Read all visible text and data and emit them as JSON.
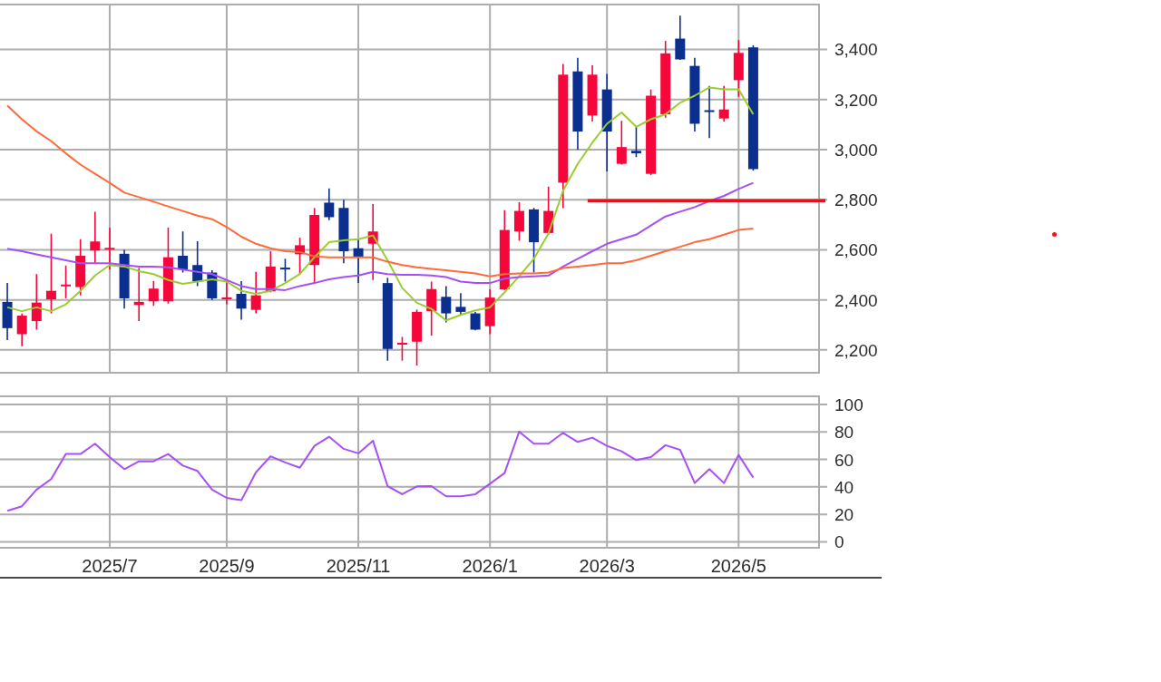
{
  "price_chart": {
    "chart_data": {
      "type": "candlestick",
      "grid": true,
      "ylim": [
        2109,
        3579
      ],
      "categories": [
        null,
        null,
        null,
        null,
        null,
        null,
        null,
        null,
        null,
        null,
        null,
        null,
        null,
        null,
        null,
        null,
        null,
        null,
        null,
        null,
        null,
        null,
        null,
        null,
        null,
        null,
        null,
        null,
        null,
        null,
        null,
        null,
        null,
        null,
        null,
        null,
        null,
        null,
        null,
        null,
        null,
        null,
        null,
        null,
        null,
        null,
        null,
        null,
        null,
        null,
        null,
        null,
        null,
        null,
        null,
        null
      ],
      "yticks": [
        {
          "value": 2200,
          "label": "2,200"
        },
        {
          "value": 2400,
          "label": "2,400"
        },
        {
          "value": 2600,
          "label": "2,600"
        },
        {
          "value": 2800,
          "label": "2,800"
        },
        {
          "value": 3000,
          "label": "3,000"
        },
        {
          "value": 3200,
          "label": "3,200"
        },
        {
          "value": 3400,
          "label": "3,400"
        }
      ],
      "ohlc": [
        [
          2392,
          2467,
          2239,
          2287
        ],
        [
          2263,
          2345,
          2215,
          2337
        ],
        [
          2315,
          2503,
          2281,
          2389
        ],
        [
          2402,
          2664,
          2346,
          2436
        ],
        [
          2455,
          2537,
          2406,
          2460
        ],
        [
          2451,
          2642,
          2418,
          2576
        ],
        [
          2597,
          2752,
          2546,
          2633
        ],
        [
          2602,
          2688,
          2521,
          2606
        ],
        [
          2584,
          2600,
          2365,
          2406
        ],
        [
          2379,
          2527,
          2315,
          2392
        ],
        [
          2394,
          2475,
          2376,
          2445
        ],
        [
          2394,
          2688,
          2385,
          2570
        ],
        [
          2576,
          2673,
          2509,
          2521
        ],
        [
          2539,
          2634,
          2455,
          2473
        ],
        [
          2509,
          2518,
          2400,
          2406
        ],
        [
          2404,
          2473,
          2382,
          2408
        ],
        [
          2424,
          2475,
          2321,
          2365
        ],
        [
          2360,
          2512,
          2346,
          2418
        ],
        [
          2434,
          2594,
          2430,
          2533
        ],
        [
          2527,
          2564,
          2473,
          2523
        ],
        [
          2582,
          2648,
          2503,
          2618
        ],
        [
          2539,
          2767,
          2467,
          2739
        ],
        [
          2788,
          2845,
          2718,
          2730
        ],
        [
          2767,
          2800,
          2546,
          2594
        ],
        [
          2606,
          2642,
          2467,
          2570
        ],
        [
          2624,
          2782,
          2479,
          2673
        ],
        [
          2467,
          2488,
          2157,
          2204
        ],
        [
          2222,
          2252,
          2157,
          2228
        ],
        [
          2233,
          2361,
          2138,
          2352
        ],
        [
          2355,
          2473,
          2257,
          2443
        ],
        [
          2412,
          2455,
          2310,
          2346
        ],
        [
          2372,
          2427,
          2337,
          2352
        ],
        [
          2346,
          2352,
          2278,
          2281
        ],
        [
          2295,
          2442,
          2263,
          2409
        ],
        [
          2442,
          2758,
          2439,
          2679
        ],
        [
          2673,
          2790,
          2636,
          2755
        ],
        [
          2761,
          2767,
          2509,
          2630
        ],
        [
          2667,
          2852,
          2660,
          2755
        ],
        [
          2868,
          3342,
          2766,
          3299
        ],
        [
          3312,
          3366,
          3000,
          3072
        ],
        [
          3136,
          3336,
          3112,
          3299
        ],
        [
          3240,
          3302,
          2913,
          3072
        ],
        [
          2943,
          3115,
          2940,
          3010
        ],
        [
          2995,
          3091,
          2970,
          2985
        ],
        [
          2903,
          3240,
          2898,
          3215
        ],
        [
          3141,
          3434,
          3127,
          3384
        ],
        [
          3443,
          3535,
          3358,
          3360
        ],
        [
          3334,
          3366,
          3072,
          3103
        ],
        [
          3157,
          3254,
          3046,
          3150
        ],
        [
          3124,
          3254,
          3112,
          3160
        ],
        [
          3277,
          3437,
          3211,
          3386
        ],
        [
          3408,
          3416,
          2916,
          2922
        ],
        null,
        null,
        null,
        null
      ],
      "series": [
        {
          "type": "line",
          "color": "#9ccd2e",
          "values": [
            2370,
            2355,
            2370,
            2355,
            2382,
            2436,
            2497,
            2539,
            2533,
            2515,
            2503,
            2479,
            2464,
            2473,
            2482,
            2473,
            2436,
            2424,
            2436,
            2467,
            2503,
            2570,
            2630,
            2638,
            2642,
            2657,
            2558,
            2448,
            2388,
            2364,
            2318,
            2340,
            2358,
            2370,
            2430,
            2494,
            2564,
            2665,
            2836,
            2943,
            3028,
            3103,
            3148,
            3091,
            3121,
            3141,
            3187,
            3215,
            3248,
            3240,
            3240,
            3141,
            null,
            null,
            null,
            null
          ]
        },
        {
          "type": "line",
          "color": "#a64ff5",
          "values": [
            2604,
            2594,
            2582,
            2570,
            2558,
            2546,
            2546,
            2546,
            2539,
            2533,
            2533,
            2530,
            2521,
            2512,
            2503,
            2479,
            2455,
            2443,
            2443,
            2439,
            2455,
            2467,
            2482,
            2491,
            2497,
            2512,
            2503,
            2500,
            2500,
            2497,
            2491,
            2473,
            2467,
            2467,
            2485,
            2491,
            2494,
            2497,
            2533,
            2564,
            2594,
            2624,
            2642,
            2660,
            2697,
            2733,
            2752,
            2770,
            2794,
            2815,
            2843,
            2867,
            null,
            null,
            null,
            null
          ]
        },
        {
          "type": "line",
          "color": "#ff6a3a",
          "values": [
            3175,
            3121,
            3073,
            3034,
            2985,
            2940,
            2903,
            2867,
            2828,
            2810,
            2792,
            2773,
            2755,
            2736,
            2722,
            2691,
            2652,
            2624,
            2606,
            2594,
            2591,
            2573,
            2570,
            2570,
            2570,
            2570,
            2552,
            2539,
            2530,
            2524,
            2518,
            2512,
            2506,
            2494,
            2503,
            2506,
            2506,
            2509,
            2527,
            2533,
            2539,
            2546,
            2546,
            2558,
            2576,
            2594,
            2612,
            2630,
            2642,
            2660,
            2679,
            2685,
            null,
            null,
            null,
            null
          ]
        }
      ],
      "ref_lines": [
        {
          "axis": "y",
          "value": 2796,
          "color": "#e8101c"
        }
      ]
    }
  },
  "indicator_chart": {
    "chart_data": {
      "type": "line",
      "grid": true,
      "ylim": [
        -4.3,
        105.9
      ],
      "categories": [
        null,
        null,
        null,
        null,
        null,
        null,
        null,
        "2025/7",
        null,
        null,
        null,
        null,
        null,
        null,
        null,
        "2025/9",
        null,
        null,
        null,
        null,
        null,
        null,
        null,
        null,
        "2025/11",
        null,
        null,
        null,
        null,
        null,
        null,
        null,
        null,
        "2026/1",
        null,
        null,
        null,
        null,
        null,
        null,
        null,
        "2026/3",
        null,
        null,
        null,
        null,
        null,
        null,
        null,
        null,
        "2026/5",
        null,
        null,
        null,
        null,
        null
      ],
      "yticks": [
        {
          "value": 0,
          "label": "0"
        },
        {
          "value": 20,
          "label": "20"
        },
        {
          "value": 40,
          "label": "40"
        },
        {
          "value": 60,
          "label": "60"
        },
        {
          "value": 80,
          "label": "80"
        },
        {
          "value": 100,
          "label": "100"
        }
      ],
      "series": [
        {
          "color": "#a850f5",
          "values": [
            22.6,
            25.9,
            38.0,
            45.7,
            63.9,
            63.9,
            71.4,
            61.7,
            52.9,
            58.6,
            58.6,
            63.9,
            55.5,
            51.6,
            38.0,
            32.0,
            30.3,
            50.7,
            62.2,
            57.8,
            54.0,
            69.9,
            76.5,
            67.7,
            64.4,
            73.6,
            40.6,
            34.7,
            40.4,
            40.6,
            33.1,
            33.1,
            34.7,
            42.3,
            50.1,
            80.2,
            71.4,
            71.4,
            79.3,
            72.7,
            75.8,
            69.9,
            65.9,
            59.5,
            61.7,
            70.3,
            67.0,
            42.8,
            52.9,
            42.8,
            63.3,
            46.8,
            null,
            null,
            null,
            null
          ]
        }
      ]
    }
  }
}
